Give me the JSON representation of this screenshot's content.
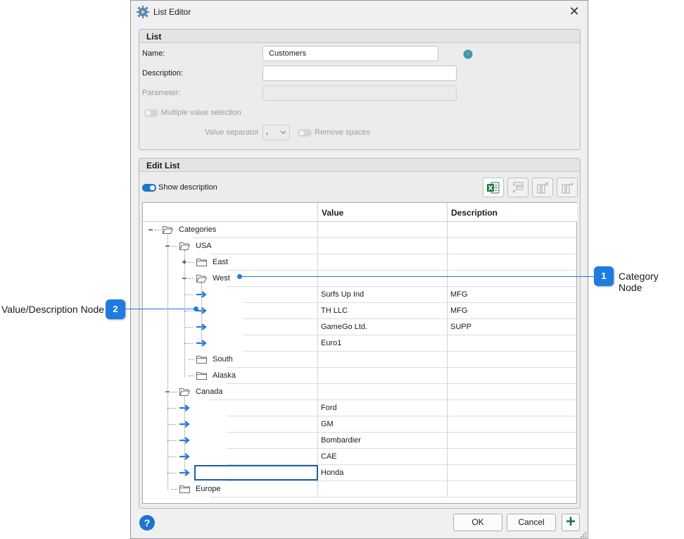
{
  "window": {
    "title": "List Editor",
    "close_glyph": "✕"
  },
  "list_group": {
    "header": "List",
    "name_label": "Name:",
    "name_value": "Customers",
    "description_label": "Description:",
    "description_value": "",
    "parameter_label": "Parameter:",
    "parameter_value": "",
    "multiple_value_label": "Multiple value selection",
    "value_separator_label": "Value separator",
    "value_separator_value": ",",
    "remove_spaces_label": "Remove spaces"
  },
  "edit_group": {
    "header": "Edit List",
    "show_description_label": "Show description",
    "show_description_on": true,
    "columns": {
      "tree": "",
      "value": "Value",
      "description": "Description"
    }
  },
  "tree": {
    "categories": "Categories",
    "usa": "USA",
    "east": "East",
    "west": "West",
    "south": "South",
    "alaska": "Alaska",
    "canada": "Canada",
    "europe": "Europe"
  },
  "rows": [
    {
      "value": "",
      "description": ""
    },
    {
      "value": "",
      "description": ""
    },
    {
      "value": "",
      "description": ""
    },
    {
      "value": "",
      "description": ""
    },
    {
      "value": "Surfs Up Ind",
      "description": "MFG"
    },
    {
      "value": "TH LLC",
      "description": "MFG"
    },
    {
      "value": "GameGo Ltd.",
      "description": "SUPP"
    },
    {
      "value": "Euro1",
      "description": ""
    },
    {
      "value": "",
      "description": ""
    },
    {
      "value": "",
      "description": ""
    },
    {
      "value": "",
      "description": ""
    },
    {
      "value": "Ford",
      "description": ""
    },
    {
      "value": "GM",
      "description": ""
    },
    {
      "value": "Bombardier",
      "description": ""
    },
    {
      "value": "CAE",
      "description": ""
    },
    {
      "value": "Honda",
      "description": ""
    },
    {
      "value": "",
      "description": ""
    }
  ],
  "footer": {
    "help_glyph": "?",
    "ok_label": "OK",
    "cancel_label": "Cancel",
    "add_glyph": "+"
  },
  "callouts": {
    "c1_number": "1",
    "c1_text": "Category Node",
    "c2_number": "2",
    "c2_text": "Value/Description Node"
  },
  "colors": {
    "accent": "#1e7be0",
    "excel_green": "#1d7a45"
  }
}
